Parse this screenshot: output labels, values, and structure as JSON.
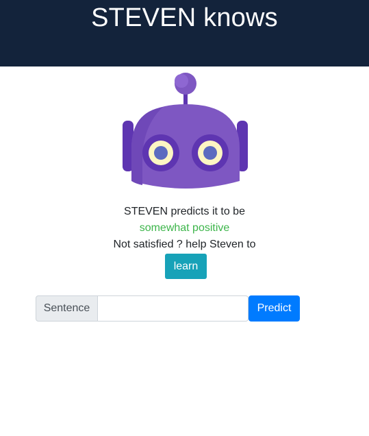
{
  "header": {
    "title": "STEVEN knows",
    "background_color": "#13233b"
  },
  "robot": {
    "icon": "robot-icon",
    "body_color": "#7e57c2",
    "accent_color": "#5e35b1"
  },
  "result": {
    "prefix": "STEVEN predicts it to be",
    "sentiment": "somewhat positive",
    "sentiment_color": "#3cb54a",
    "prompt": "Not satisfied ? help Steven to",
    "learn_label": "learn"
  },
  "form": {
    "addon_label": "Sentence",
    "input_value": "",
    "input_placeholder": "",
    "predict_label": "Predict"
  }
}
